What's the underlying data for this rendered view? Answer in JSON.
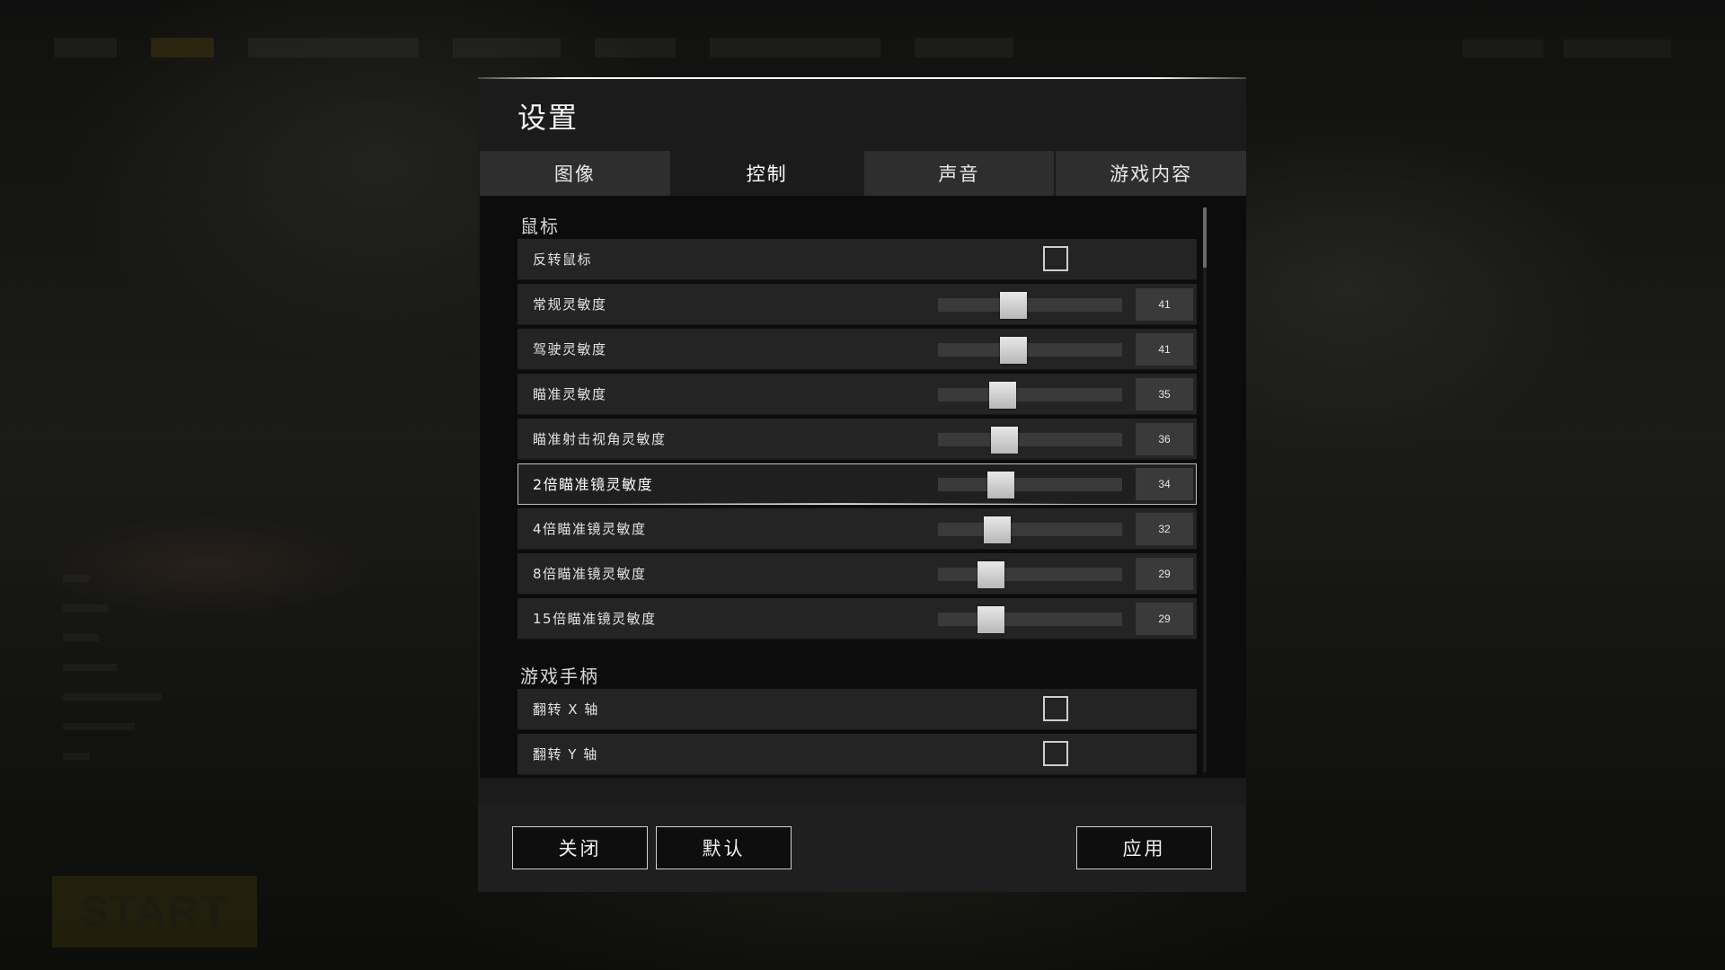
{
  "modal": {
    "title": "设置"
  },
  "tabs": [
    {
      "label": "图像",
      "active": false
    },
    {
      "label": "控制",
      "active": true
    },
    {
      "label": "声音",
      "active": false
    },
    {
      "label": "游戏内容",
      "active": false
    }
  ],
  "sections": {
    "mouse": {
      "title": "鼠标",
      "invert_mouse": {
        "label": "反转鼠标",
        "checked": false
      },
      "sliders": [
        {
          "label": "常规灵敏度",
          "value": "41",
          "fraction": 0.41
        },
        {
          "label": "驾驶灵敏度",
          "value": "41",
          "fraction": 0.41
        },
        {
          "label": "瞄准灵敏度",
          "value": "35",
          "fraction": 0.35
        },
        {
          "label": "瞄准射击视角灵敏度",
          "value": "36",
          "fraction": 0.36
        },
        {
          "label": "2倍瞄准镜灵敏度",
          "value": "34",
          "fraction": 0.34
        },
        {
          "label": "4倍瞄准镜灵敏度",
          "value": "32",
          "fraction": 0.32
        },
        {
          "label": "8倍瞄准镜灵敏度",
          "value": "29",
          "fraction": 0.29
        },
        {
          "label": "15倍瞄准镜灵敏度",
          "value": "29",
          "fraction": 0.29
        }
      ]
    },
    "gamepad": {
      "title": "游戏手柄",
      "invert_x": {
        "label": "翻转 X 轴",
        "checked": false
      },
      "invert_y": {
        "label": "翻转 Y 轴",
        "checked": false
      }
    }
  },
  "footer": {
    "close_label": "关闭",
    "default_label": "默认",
    "apply_label": "应用"
  },
  "background": {
    "start_label": "START"
  },
  "colors": {
    "panel": "#0c0c0c",
    "row": "#242424",
    "tab_inactive": "#2e2e2e",
    "slider_thumb": "#d0d0d0"
  }
}
